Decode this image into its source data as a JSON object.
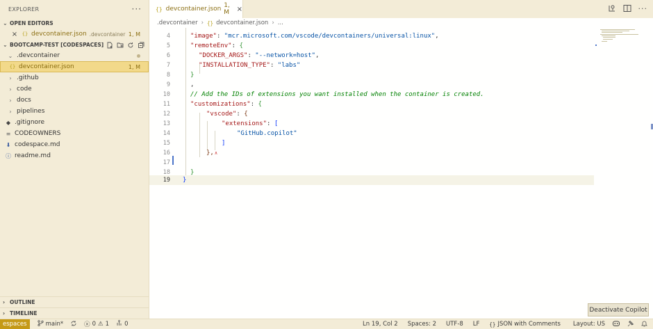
{
  "sidebar": {
    "title": "EXPLORER",
    "more": "···",
    "open_editors": {
      "label": "OPEN EDITORS",
      "file": {
        "close": "×",
        "icon": "{}",
        "name": "devcontainer.json",
        "folder": ".devcontainer",
        "badge": "1, M"
      }
    },
    "workspace": {
      "label": "BOOTCAMP-TEST [CODESPACES]",
      "actions": [
        "new-file-icon",
        "new-folder-icon",
        "refresh-icon",
        "collapse-all-icon"
      ],
      "items": [
        {
          "name": ".devcontainer",
          "type": "folder-open"
        },
        {
          "name": "devcontainer.json",
          "icon": "{}",
          "badge": "1, M"
        },
        {
          "name": ".github",
          "type": "folder"
        },
        {
          "name": "code",
          "type": "folder"
        },
        {
          "name": "docs",
          "type": "folder"
        },
        {
          "name": "pipelines",
          "type": "folder"
        },
        {
          "name": ".gitignore",
          "icon": "◆"
        },
        {
          "name": "CODEOWNERS",
          "icon": "≡"
        },
        {
          "name": "codespace.md",
          "icon": "⬇"
        },
        {
          "name": "readme.md",
          "icon": "ⓘ"
        }
      ]
    },
    "outline": "OUTLINE",
    "timeline": "TIMELINE"
  },
  "tab": {
    "icon": "{}",
    "name": "devcontainer.json",
    "badge": "1, M",
    "close": "×"
  },
  "breadcrumb": {
    "folder": ".devcontainer",
    "icon": "{}",
    "file": "devcontainer.json",
    "more": "..."
  },
  "editor": {
    "line_numbers": [
      "4",
      "5",
      "6",
      "7",
      "8",
      "9",
      "10",
      "11",
      "12",
      "13",
      "14",
      "15",
      "16",
      "17",
      "18",
      "19"
    ],
    "lines": {
      "l4_key": "\"image\"",
      "l4_colon": ": ",
      "l4_val": "\"mcr.microsoft.com/vscode/devcontainers/universal:linux\"",
      "l4_end": ",",
      "l5_key": "\"remoteEnv\"",
      "l5_colon": ": ",
      "l5_brace": "{",
      "l6_key": "\"DOCKER_ARGS\"",
      "l6_colon": ": ",
      "l6_val": "\"--network=host\"",
      "l6_end": ",",
      "l7_key": "\"INSTALLATION_TYPE\"",
      "l7_colon": ": ",
      "l7_val": "\"labs\"",
      "l8": "}",
      "l9": ",",
      "l10": "// Add the IDs of extensions you want installed when the container is created.",
      "l11_key": "\"customizations\"",
      "l11_colon": ": ",
      "l11_brace": "{",
      "l12_key": "\"vscode\"",
      "l12_colon": ": ",
      "l12_brace": "{",
      "l13_key": "\"extensions\"",
      "l13_colon": ": ",
      "l13_brace": "[",
      "l14_val": "\"GitHub.copilot\"",
      "l15": "]",
      "l16": "},",
      "l18": "}",
      "l19": "}"
    }
  },
  "tooltip": "Deactivate Copilot",
  "statusbar": {
    "remote": "espaces",
    "branch": "main*",
    "errors": "0",
    "warnings": "1",
    "ports": "0",
    "position": "Ln 19, Col 2",
    "spaces": "Spaces: 2",
    "encoding": "UTF-8",
    "eol": "LF",
    "language": "JSON with Comments",
    "layout": "Layout: US"
  }
}
